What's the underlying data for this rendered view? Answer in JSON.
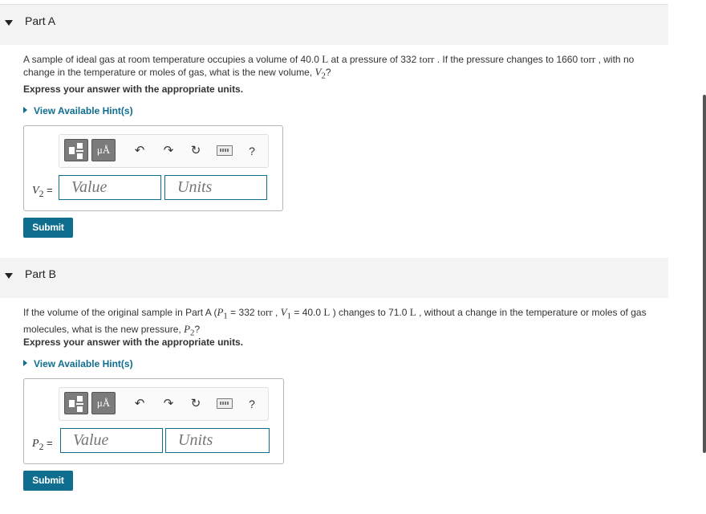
{
  "partA": {
    "title": "Part A",
    "q_text1": "A sample of ideal gas at room temperature occupies a volume of 40.0 ",
    "q_unit1": "L",
    "q_text2": " at a pressure of 332 ",
    "q_unit2": "torr",
    "q_text3": " . If the pressure changes to 1660 ",
    "q_unit3": "torr",
    "q_text4": " , with no change in the temperature or moles of gas, what is the new volume, ",
    "q_var": "V",
    "q_sub": "2",
    "q_end": "?",
    "instruction": "Express your answer with the appropriate units.",
    "hint": "View Available Hint(s)",
    "units_btn": "μÅ",
    "undo_icon": "↶",
    "redo_icon": "↷",
    "reset_icon": "↻",
    "help_icon": "?",
    "var_name": "V",
    "var_sub": "2",
    "var_eq": " =",
    "value_placeholder": "Value",
    "units_placeholder": "Units",
    "submit": "Submit"
  },
  "partB": {
    "title": "Part B",
    "q_text1": "If the volume of the original sample in Part A (",
    "p1_var": "P",
    "p1_sub": "1",
    "q_text2": " = 332 ",
    "q_unit1": "torr",
    "q_text3": " , ",
    "v1_var": "V",
    "v1_sub": "1",
    "q_text4": " = 40.0 ",
    "q_unit2": "L",
    "q_text5": " ) changes to 71.0 ",
    "q_unit3": "L",
    "q_text6": " , without a change in the temperature or moles of gas molecules, what is the new pressure, ",
    "q_var": "P",
    "q_sub": "2",
    "q_end": "?",
    "instruction": "Express your answer with the appropriate units.",
    "hint": "View Available Hint(s)",
    "units_btn": "μÅ",
    "undo_icon": "↶",
    "redo_icon": "↷",
    "reset_icon": "↻",
    "help_icon": "?",
    "var_name": "P",
    "var_sub": "2",
    "var_eq": " =",
    "value_placeholder": "Value",
    "units_placeholder": "Units",
    "submit": "Submit"
  },
  "colors": {
    "accent": "#0f6e8f",
    "header_bg": "#f3f3f3"
  }
}
